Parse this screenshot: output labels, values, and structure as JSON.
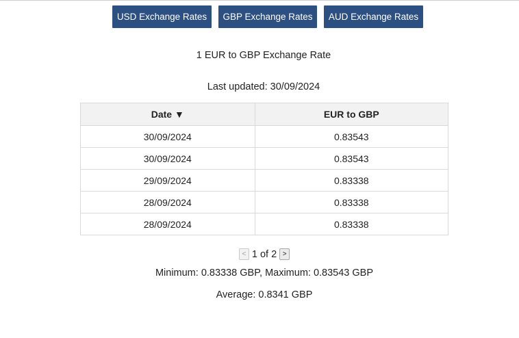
{
  "nav": {
    "usd_label": "USD Exchange Rates",
    "gbp_label": "GBP Exchange Rates",
    "aud_label": "AUD Exchange Rates"
  },
  "heading": {
    "title": "1 EUR to GBP Exchange Rate",
    "last_updated_label": "Last updated:",
    "last_updated_value": "30/09/2024"
  },
  "table": {
    "headers": {
      "date": "Date",
      "sort_indicator": "▼",
      "rate": "EUR to GBP"
    },
    "rows": [
      {
        "date": "30/09/2024",
        "rate": "0.83543"
      },
      {
        "date": "30/09/2024",
        "rate": "0.83543"
      },
      {
        "date": "29/09/2024",
        "rate": "0.83338"
      },
      {
        "date": "28/09/2024",
        "rate": "0.83338"
      },
      {
        "date": "28/09/2024",
        "rate": "0.83338"
      }
    ]
  },
  "pagination": {
    "prev_label": "<",
    "next_label": ">",
    "text": "1 of 2"
  },
  "stats": {
    "min_max": "Minimum: 0.83338 GBP, Maximum: 0.83543 GBP",
    "average": "Average: 0.8341 GBP"
  },
  "colors": {
    "button_bg": "#2d5083",
    "header_bg": "#f2f2f2"
  }
}
